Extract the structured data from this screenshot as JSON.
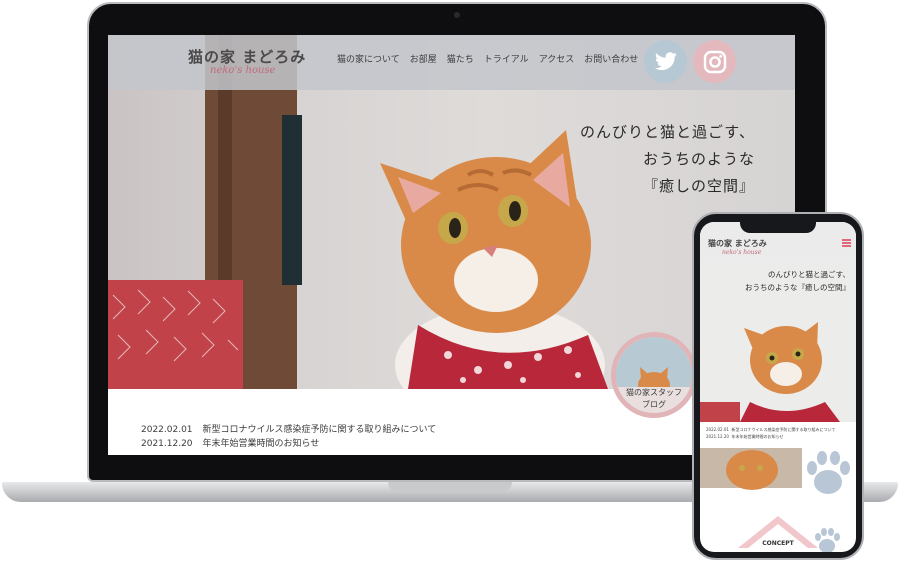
{
  "laptop_site": {
    "logo": {
      "title": "猫の家 まどろみ",
      "subtitle": "neko's house"
    },
    "nav": [
      {
        "label": "猫の家について"
      },
      {
        "label": "お部屋"
      },
      {
        "label": "猫たち"
      },
      {
        "label": "トライアル"
      },
      {
        "label": "アクセス"
      },
      {
        "label": "お問い合わせ"
      }
    ],
    "social": {
      "twitter": "twitter-icon",
      "instagram": "instagram-icon"
    },
    "hero_text": [
      "のんびりと猫と過ごす、",
      "おうちのような",
      "『癒しの空間』"
    ],
    "staff_blog": [
      "猫の家スタッフ",
      "ブログ"
    ],
    "news": [
      {
        "date": "2022.02.01",
        "title": "新型コロナウイルス感染症予防に関する取り組みについて"
      },
      {
        "date": "2021.12.20",
        "title": "年末年始営業時間のお知らせ"
      }
    ]
  },
  "phone_site": {
    "logo": {
      "title": "猫の家 まどろみ",
      "subtitle": "neko's house"
    },
    "hero_text": [
      "のんびりと猫と過ごす、",
      "おうちのような『癒しの空間』"
    ],
    "news": [
      {
        "date": "2022.02.01",
        "title": "新型コロナウイルス感染症予防に関する取り組みについて"
      },
      {
        "date": "2021.12.20",
        "title": "年末年始営業時間のお知らせ"
      }
    ],
    "concept_label": "CONCEPT"
  },
  "colors": {
    "accent_pink": "#e1b4b8",
    "accent_blue": "#b5c8d3",
    "paw_blue": "#b8c6d6",
    "bandana_red": "#b8283a",
    "cat_orange": "#d98a48"
  }
}
